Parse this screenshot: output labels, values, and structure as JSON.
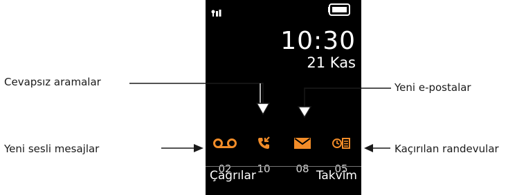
{
  "status": {
    "signal_icon": "signal-icon",
    "battery_icon": "battery-icon"
  },
  "clock": {
    "time": "10:30",
    "date": "21 Kas"
  },
  "indicators": [
    {
      "icon": "voicemail-icon",
      "count": "02"
    },
    {
      "icon": "missed-call-icon",
      "count": "10"
    },
    {
      "icon": "email-icon",
      "count": "08"
    },
    {
      "icon": "missed-appointment-icon",
      "count": "05"
    }
  ],
  "softkeys": {
    "left": "Çagrılar",
    "right": "Takvim"
  },
  "callouts": {
    "missed_calls": "Cevapsız aramalar",
    "new_voicemail": "Yeni sesli mesajlar",
    "new_email": "Yeni e-postalar",
    "missed_appointments": "Kaçırılan randevular"
  },
  "colors": {
    "accent": "#f28c28",
    "screen_bg": "#000000"
  }
}
